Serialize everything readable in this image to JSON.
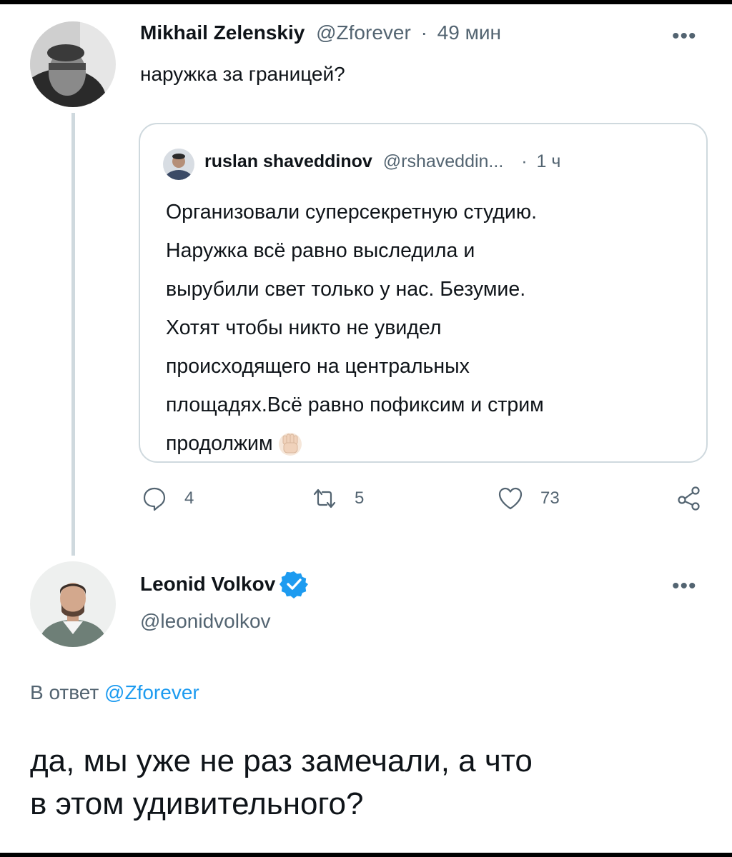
{
  "tweet1": {
    "author_name": "Mikhail Zelenskiy",
    "handle": "@Zforever",
    "separator": "·",
    "time": "49 мин",
    "text": "наружка за границей?",
    "more_label": "•••"
  },
  "quote": {
    "author_name": "ruslan shaveddinov",
    "handle": "@rshaveddin...",
    "separator": "·",
    "time": "1 ч",
    "text": "Организовали суперсекретную студию.\nНаружка всё равно выследила и\nвырубили свет только у нас. Безумие.\nХотят чтобы никто не увидел\nпроисходящего на центральных\nплощадях.Всё равно пофиксим и стрим\nпродолжим",
    "emoji": "raised-fist-icon"
  },
  "actions": {
    "reply_count": "4",
    "retweet_count": "5",
    "like_count": "73"
  },
  "tweet2": {
    "author_name": "Leonid Volkov",
    "handle": "@leonidvolkov",
    "more_label": "•••",
    "reply_prefix": "В ответ",
    "reply_to": "@Zforever",
    "text": "да, мы уже не раз замечали, а что\nв этом удивительного?"
  },
  "colors": {
    "text": "#0f1419",
    "muted": "#536471",
    "link": "#1d9bf0",
    "verified": "#1d9bf0",
    "border": "#cfd9de"
  }
}
